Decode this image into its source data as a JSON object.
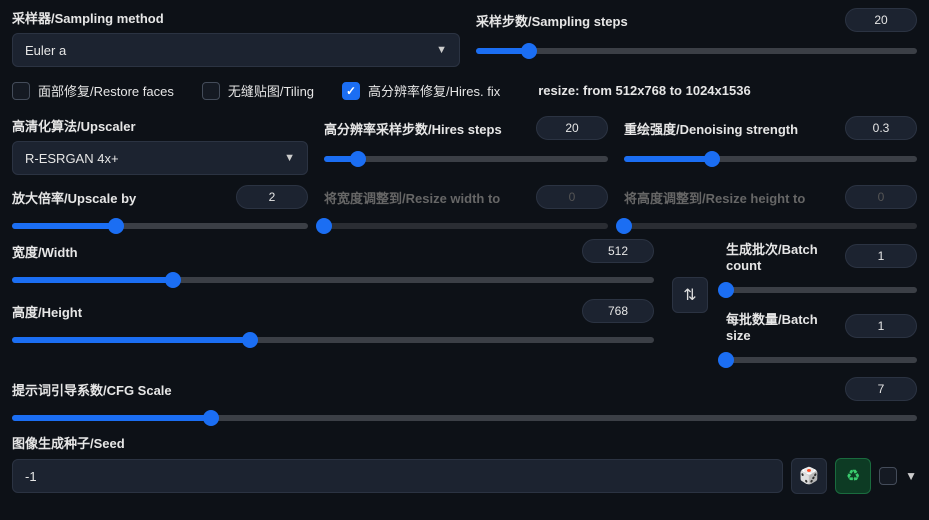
{
  "sampling_method": {
    "label": "采样器/Sampling method",
    "value": "Euler a"
  },
  "sampling_steps": {
    "label": "采样步数/Sampling steps",
    "value": "20",
    "pct": 12
  },
  "restore_faces": {
    "label": "面部修复/Restore faces",
    "checked": false
  },
  "tiling": {
    "label": "无缝贴图/Tiling",
    "checked": false
  },
  "hires_fix": {
    "label": "高分辨率修复/Hires. fix",
    "checked": true
  },
  "resize_text": "resize: from 512x768 to 1024x1536",
  "upscaler": {
    "label": "高清化算法/Upscaler",
    "value": "R-ESRGAN 4x+"
  },
  "hires_steps": {
    "label": "高分辨率采样步数/Hires steps",
    "value": "20",
    "pct": 12
  },
  "denoise": {
    "label": "重绘强度/Denoising strength",
    "value": "0.3",
    "pct": 30
  },
  "upscale_by": {
    "label": "放大倍率/Upscale by",
    "value": "2",
    "pct": 35
  },
  "resize_w": {
    "label": "将宽度调整到/Resize width to",
    "value": "0",
    "pct": 0
  },
  "resize_h": {
    "label": "将高度调整到/Resize height to",
    "value": "0",
    "pct": 0
  },
  "width": {
    "label": "宽度/Width",
    "value": "512",
    "pct": 25
  },
  "height": {
    "label": "高度/Height",
    "value": "768",
    "pct": 37
  },
  "batch_count": {
    "label": "生成批次/Batch count",
    "value": "1",
    "pct": 0
  },
  "batch_size": {
    "label": "每批数量/Batch size",
    "value": "1",
    "pct": 0
  },
  "cfg": {
    "label": "提示词引导系数/CFG Scale",
    "value": "7",
    "pct": 22
  },
  "seed": {
    "label": "图像生成种子/Seed",
    "value": "-1"
  }
}
